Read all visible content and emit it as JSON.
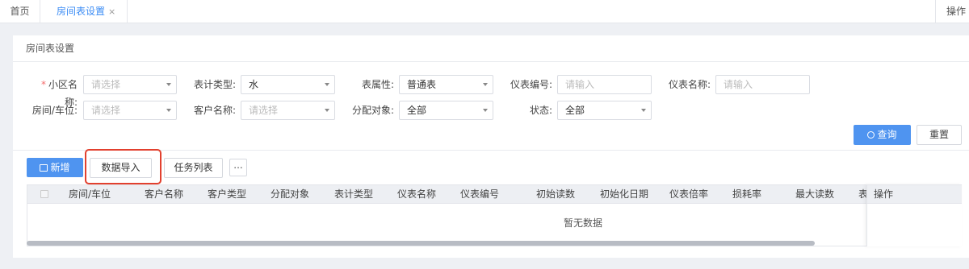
{
  "tabs": {
    "home": "首页",
    "active": "房间表设置",
    "close": "×",
    "ops": "操作"
  },
  "card": {
    "title": "房间表设置"
  },
  "form": {
    "community": {
      "label": "小区名称:",
      "required": "*",
      "placeholder": "请选择"
    },
    "meter_type": {
      "label": "表计类型:",
      "value": "水"
    },
    "meter_attr": {
      "label": "表属性:",
      "value": "普通表"
    },
    "meter_no": {
      "label": "仪表编号:",
      "placeholder": "请输入"
    },
    "meter_name": {
      "label": "仪表名称:",
      "placeholder": "请输入"
    },
    "room": {
      "label": "房间/车位:",
      "placeholder": "请选择"
    },
    "customer": {
      "label": "客户名称:",
      "placeholder": "请选择"
    },
    "alloc": {
      "label": "分配对象:",
      "value": "全部"
    },
    "status": {
      "label": "状态:",
      "value": "全部"
    }
  },
  "buttons": {
    "query": "查询",
    "reset": "重置",
    "new": "新增",
    "import": "数据导入",
    "tasks": "任务列表",
    "more": "..."
  },
  "table": {
    "columns": [
      "房间/车位",
      "客户名称",
      "客户类型",
      "分配对象",
      "表计类型",
      "仪表名称",
      "仪表编号",
      "初始读数",
      "初始化日期",
      "仪表倍率",
      "损耗率",
      "最大读数",
      "表"
    ],
    "ops_column": "操作",
    "empty": "暂无数据"
  },
  "colors": {
    "primary": "#4f94f0",
    "active_tab": "#3b8cf5",
    "highlight": "#e2402e",
    "required": "#f56c6c"
  }
}
